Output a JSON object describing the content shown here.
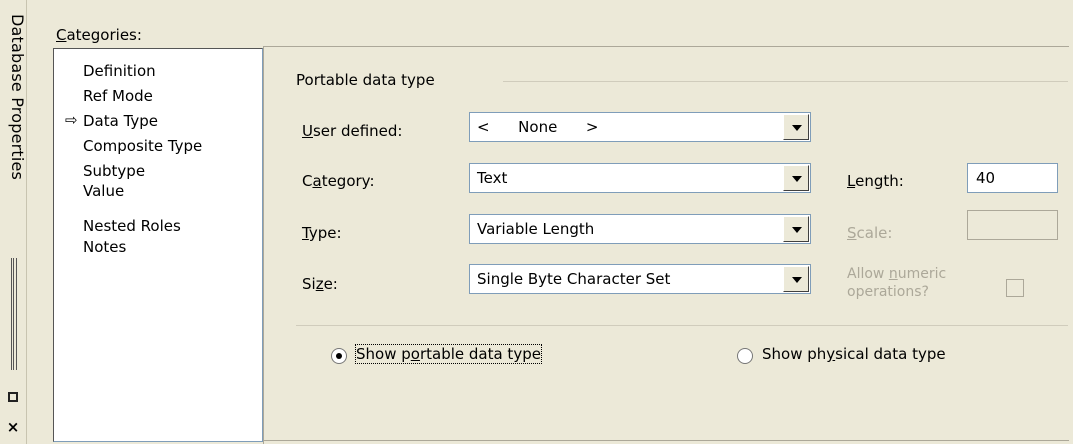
{
  "sidebar_caption": {
    "title": "Database Properties",
    "pin_icon": "restore-square-icon",
    "close_icon": "close-icon",
    "close_glyph": "×"
  },
  "categories": {
    "label_pre": "",
    "label_u": "C",
    "label_post": "ategories:",
    "selected_marker": "⇨",
    "items": [
      "Definition",
      "Ref Mode",
      "Data Type",
      "Composite Type",
      "Subtype",
      "Value",
      "Nested Roles",
      "Notes"
    ],
    "selected_index": 2
  },
  "portable": {
    "group_title": "Portable data type",
    "user_defined": {
      "label_u": "U",
      "label_post": "ser defined:",
      "value": "<      None      >"
    },
    "category": {
      "label_pre": "C",
      "label_u": "a",
      "label_post": "tegory:",
      "value": "Text"
    },
    "type": {
      "label_u": "T",
      "label_post": "ype:",
      "value": "Variable Length"
    },
    "size": {
      "label_pre": "Si",
      "label_u": "z",
      "label_post": "e:",
      "value": "Single Byte Character Set"
    },
    "length": {
      "label_u": "L",
      "label_post": "ength:",
      "value": "40"
    },
    "scale": {
      "label_u": "S",
      "label_post": "cale:",
      "value": ""
    },
    "allow_numeric": {
      "line1_pre": "Allow ",
      "line1_u": "n",
      "line1_post": "umeric",
      "line2": "operations?",
      "checked": false
    }
  },
  "view_mode": {
    "portable": {
      "label_pre": "Show p",
      "label_u": "o",
      "label_post": "rtable data type",
      "selected": true
    },
    "physical": {
      "label_pre": "Show ph",
      "label_u": "y",
      "label_post": "sical data type",
      "selected": false
    }
  },
  "colors": {
    "background": "#ece9d8",
    "border": "#7f9db9",
    "disabled_text": "#aca899"
  }
}
